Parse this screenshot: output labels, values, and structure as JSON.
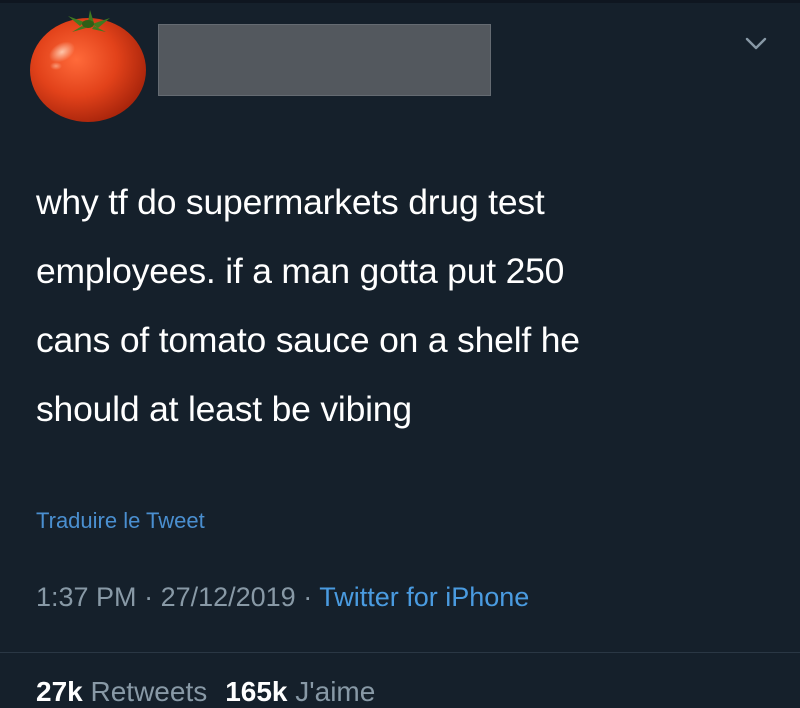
{
  "tweet": {
    "text_lines": [
      "why tf do supermarkets drug test",
      "employees. if a man gotta put 250",
      "cans of tomato sauce on a shelf he",
      "should at least be vibing"
    ],
    "translate_label": "Traduire le Tweet",
    "time": "1:37 PM",
    "separator": " · ",
    "date": "27/12/2019",
    "source": "Twitter for iPhone",
    "retweets_count": "27k",
    "retweets_label": "Retweets",
    "likes_count": "165k",
    "likes_label": "J'aime"
  },
  "icons": {
    "avatar": "tomato-avatar",
    "menu": "chevron-down-icon"
  },
  "colors": {
    "background": "#15202b",
    "link": "#4a9be0",
    "muted": "#8899a6",
    "redaction": "#53585e"
  }
}
